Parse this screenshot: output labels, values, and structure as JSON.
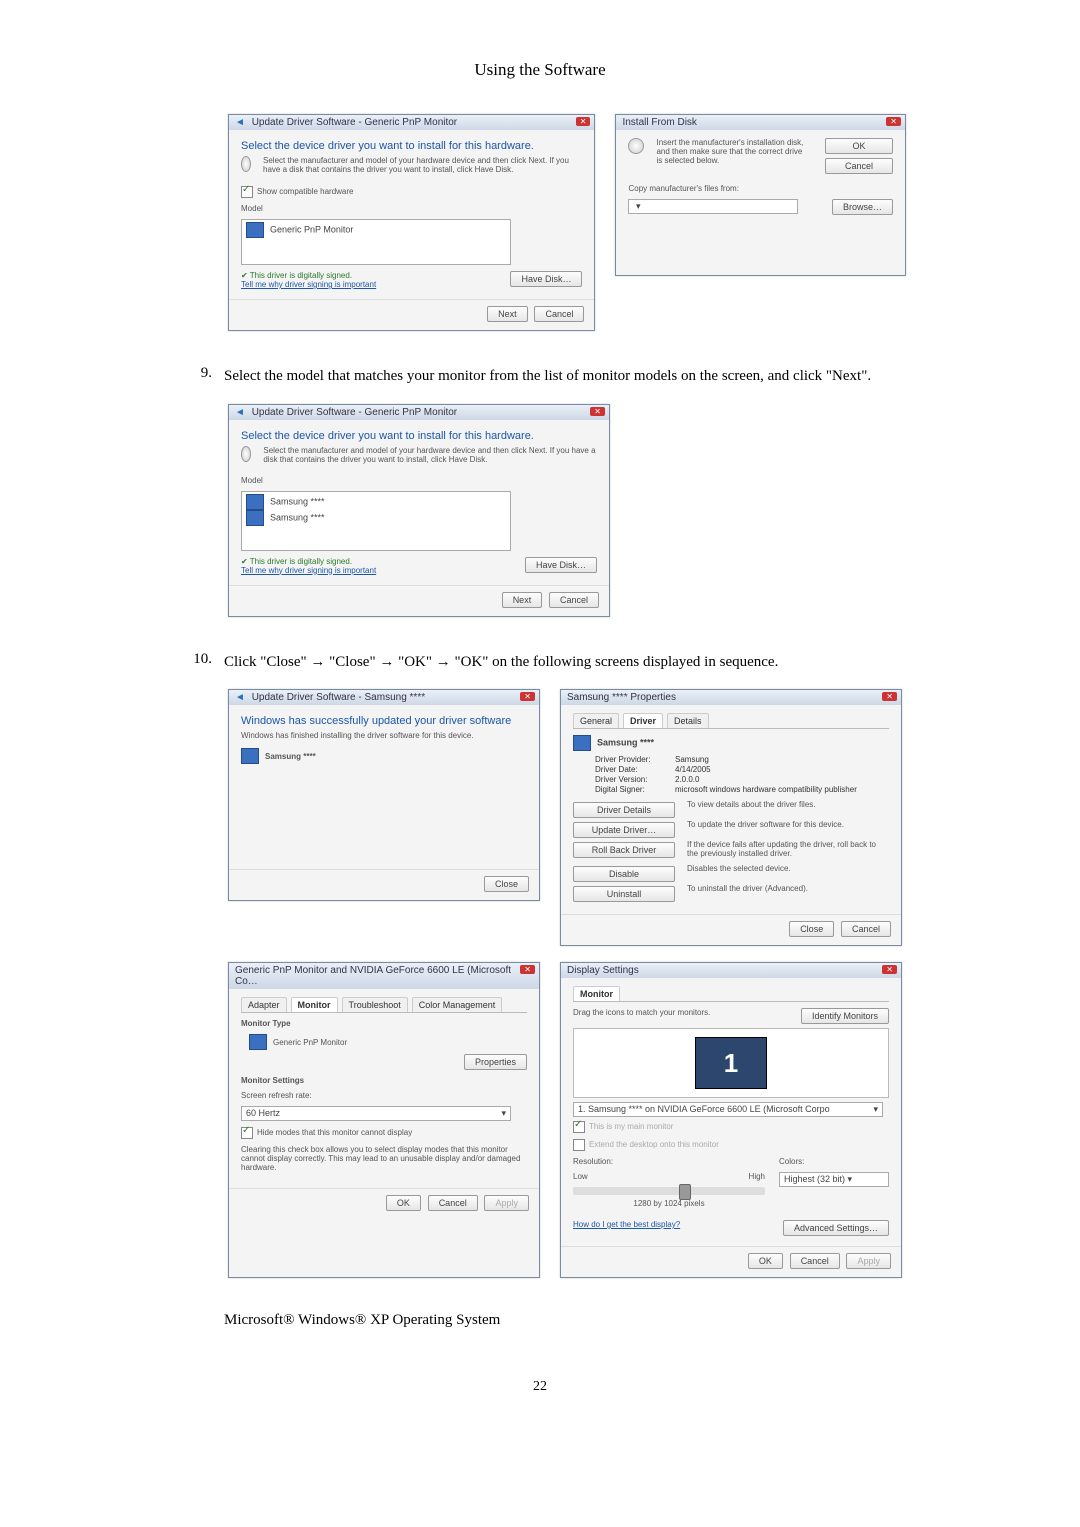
{
  "section_title": "Using the Software",
  "step9": {
    "num": "9.",
    "text": "Select the model that matches your monitor from the list of monitor models on the screen, and click \"Next\"."
  },
  "step10": {
    "num": "10.",
    "text": "Click \"Close\" → \"Close\" → \"OK\" → \"OK\" on the following screens displayed in sequence."
  },
  "dlg_update1": {
    "title": "Update Driver Software - Generic PnP Monitor",
    "heading": "Select the device driver you want to install for this hardware.",
    "sub": "Select the manufacturer and model of your hardware device and then click Next. If you have a disk that contains the driver you want to install, click Have Disk.",
    "show_compat": "Show compatible hardware",
    "model_label": "Model",
    "item": "Generic PnP Monitor",
    "signed": "This driver is digitally signed.",
    "link": "Tell me why driver signing is important",
    "have_disk": "Have Disk…",
    "next": "Next",
    "cancel": "Cancel"
  },
  "dlg_install": {
    "title": "Install From Disk",
    "text": "Insert the manufacturer's installation disk, and then make sure that the correct drive is selected below.",
    "ok": "OK",
    "cancel": "Cancel",
    "copy": "Copy manufacturer's files from:",
    "browse": "Browse…"
  },
  "dlg_update2": {
    "title": "Update Driver Software - Generic PnP Monitor",
    "heading": "Select the device driver you want to install for this hardware.",
    "sub": "Select the manufacturer and model of your hardware device and then click Next. If you have a disk that contains the driver you want to install, click Have Disk.",
    "model_label": "Model",
    "item1": "Samsung ****",
    "item2": "Samsung ****",
    "signed": "This driver is digitally signed.",
    "link": "Tell me why driver signing is important",
    "have_disk": "Have Disk…",
    "next": "Next",
    "cancel": "Cancel"
  },
  "dlg_success": {
    "title": "Update Driver Software - Samsung ****",
    "heading": "Windows has successfully updated your driver software",
    "sub": "Windows has finished installing the driver software for this device.",
    "item": "Samsung ****",
    "close": "Close"
  },
  "dlg_props": {
    "title": "Samsung **** Properties",
    "tabs": {
      "general": "General",
      "driver": "Driver",
      "details": "Details"
    },
    "device": "Samsung ****",
    "kv": {
      "provider_k": "Driver Provider:",
      "provider_v": "Samsung",
      "date_k": "Driver Date:",
      "date_v": "4/14/2005",
      "version_k": "Driver Version:",
      "version_v": "2.0.0.0",
      "signer_k": "Digital Signer:",
      "signer_v": "microsoft windows hardware compatibility publisher"
    },
    "btns": {
      "details": "Driver Details",
      "details_t": "To view details about the driver files.",
      "update": "Update Driver…",
      "update_t": "To update the driver software for this device.",
      "rollback": "Roll Back Driver",
      "rollback_t": "If the device fails after updating the driver, roll back to the previously installed driver.",
      "disable": "Disable",
      "disable_t": "Disables the selected device.",
      "uninstall": "Uninstall",
      "uninstall_t": "To uninstall the driver (Advanced)."
    },
    "close": "Close",
    "cancel": "Cancel"
  },
  "dlg_monprops": {
    "title": "Generic PnP Monitor and NVIDIA GeForce 6600 LE (Microsoft Co…",
    "tabs": {
      "adapter": "Adapter",
      "monitor": "Monitor",
      "troubleshoot": "Troubleshoot",
      "color": "Color Management"
    },
    "mtype": "Monitor Type",
    "mon": "Generic PnP Monitor",
    "properties": "Properties",
    "msettings": "Monitor Settings",
    "refresh_label": "Screen refresh rate:",
    "refresh_val": "60 Hertz",
    "hide": "Hide modes that this monitor cannot display",
    "hide_desc": "Clearing this check box allows you to select display modes that this monitor cannot display correctly. This may lead to an unusable display and/or damaged hardware.",
    "ok": "OK",
    "cancel": "Cancel",
    "apply": "Apply"
  },
  "dlg_display": {
    "title": "Display Settings",
    "tab": "Monitor",
    "drag": "Drag the icons to match your monitors.",
    "identify": "Identify Monitors",
    "monitor_num": "1",
    "monitor_sel": "1. Samsung **** on NVIDIA GeForce 6600 LE (Microsoft Corpo",
    "main": "This is my main monitor",
    "extend": "Extend the desktop onto this monitor",
    "res_label": "Resolution:",
    "low": "Low",
    "high": "High",
    "res_val": "1280 by 1024 pixels",
    "colors_label": "Colors:",
    "colors_val": "Highest (32 bit)",
    "best": "How do I get the best display?",
    "adv": "Advanced Settings…",
    "ok": "OK",
    "cancel": "Cancel",
    "apply": "Apply"
  },
  "os_line": "Microsoft® Windows® XP Operating System",
  "page_number": "22"
}
